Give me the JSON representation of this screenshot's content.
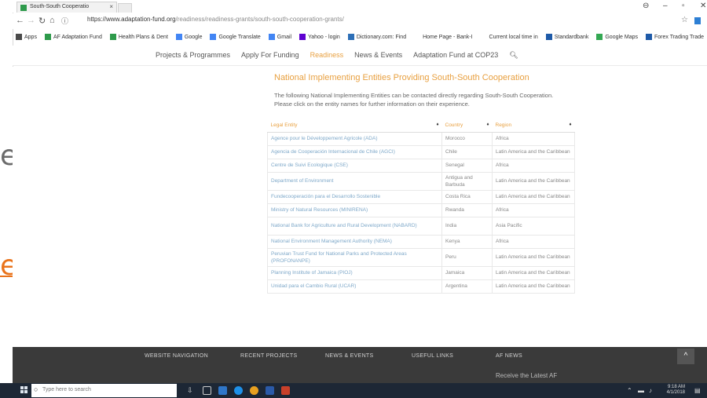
{
  "slide": {
    "fragment_top": "e:",
    "fragment_link": "e"
  },
  "browser": {
    "tab_title": "South-South Cooperatio",
    "tab_close": "×",
    "url_host": "https://www.adaptation-fund.org",
    "url_path": "/readiness/readiness-grants/south-south-cooperation-grants/",
    "bookmarks": [
      {
        "label": "Apps",
        "color": "#4a4a4a"
      },
      {
        "label": "AF Adaptation Fund",
        "color": "#2e9a4b"
      },
      {
        "label": "Health Plans & Dent",
        "color": "#2e9a4b"
      },
      {
        "label": "Google",
        "color": "#4285f4"
      },
      {
        "label": "Google Translate",
        "color": "#4285f4"
      },
      {
        "label": "Gmail",
        "color": "#4285f4"
      },
      {
        "label": "Yahoo - login",
        "color": "#5f01d1"
      },
      {
        "label": "Dictionary.com: Find",
        "color": "#2d6fb7"
      },
      {
        "label": "Home Page - Bank-I",
        "color": "#ffffff"
      },
      {
        "label": "Current local time in",
        "color": "#ffffff"
      },
      {
        "label": "Standardbank",
        "color": "#1e5aa8"
      },
      {
        "label": "Google Maps",
        "color": "#34a853"
      },
      {
        "label": "Forex Trading Trade",
        "color": "#1e5aa8"
      }
    ]
  },
  "nav": {
    "items": [
      "Projects & Programmes",
      "Apply For Funding",
      "Readiness",
      "News & Events",
      "Adaptation Fund at COP23"
    ],
    "active_index": 2
  },
  "page": {
    "heading": "National Implementing Entities Providing South-South Cooperation",
    "intro": "The following National Implementing Entities can be contacted directly regarding South-South Cooperation. Please click on the entity names for further information on their experience.",
    "columns": [
      "Legal Entity",
      "Country",
      "Region"
    ],
    "sort_glyph": "♦",
    "rows": [
      {
        "entity": "Agence pour le Développement Agricole (ADA)",
        "country": "Morocco",
        "region": "Africa"
      },
      {
        "entity": "Agencia de Cooperación Internacional de Chile (AGCI)",
        "country": "Chile",
        "region": "Latin America and the Caribbean"
      },
      {
        "entity": "Centre de Suivi Ecologique (CSE)",
        "country": "Senegal",
        "region": "Africa"
      },
      {
        "entity": "Department of Environment",
        "country": "Antigua and Barbuda",
        "region": "Latin America and the Caribbean"
      },
      {
        "entity": "Fundecooperación para el Desarrollo Sostenible",
        "country": "Costa Rica",
        "region": "Latin America and the Caribbean"
      },
      {
        "entity": "Ministry of Natural Resources (MINIRENA)",
        "country": "Rwanda",
        "region": "Africa"
      },
      {
        "entity": "National Bank for Agriculture and Rural Development (NABARD)",
        "country": "India",
        "region": "Asia Pacific"
      },
      {
        "entity": "National Environment Management Authority (NEMA)",
        "country": "Kenya",
        "region": "Africa"
      },
      {
        "entity": "Peruvian Trust Fund for National Parks and Protected Areas (PROFONANPE)",
        "country": "Peru",
        "region": "Latin America and the Caribbean"
      },
      {
        "entity": "Planning Institute of Jamaica (PIOJ)",
        "country": "Jamaica",
        "region": "Latin America and the Caribbean"
      },
      {
        "entity": "Unidad para el Cambio Rural (UCAR)",
        "country": "Argentina",
        "region": "Latin America and the Caribbean"
      }
    ]
  },
  "footer": {
    "headings": [
      "WEBSITE NAVIGATION",
      "RECENT PROJECTS",
      "NEWS & EVENTS",
      "USEFUL LINKS",
      "AF NEWS"
    ],
    "news_teaser": "Receive the Latest AF"
  },
  "taskbar": {
    "search_placeholder": "Type here to search",
    "time": "9:18 AM",
    "date": "4/1/2018"
  }
}
